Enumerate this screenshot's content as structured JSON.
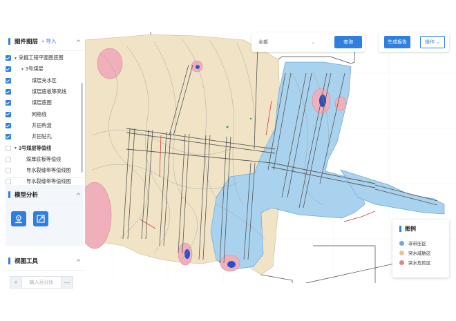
{
  "layers": {
    "title": "图件图层",
    "import_label": "+ 导入",
    "items": [
      {
        "label": "采掘工程平面图底图",
        "checked": true,
        "has_arrow": true,
        "bold": false
      },
      {
        "label": "3号煤层",
        "checked": true,
        "has_arrow": true,
        "bold": false
      },
      {
        "label": "煤层充水区",
        "checked": true,
        "has_arrow": false,
        "bold": false
      },
      {
        "label": "煤层底板等高线",
        "checked": true,
        "has_arrow": false,
        "bold": false
      },
      {
        "label": "煤层底图",
        "checked": true,
        "has_arrow": false,
        "bold": false
      },
      {
        "label": "网格线",
        "checked": true,
        "has_arrow": false,
        "bold": false
      },
      {
        "label": "井田构造",
        "checked": true,
        "has_arrow": false,
        "bold": false
      },
      {
        "label": "井田钻孔",
        "checked": true,
        "has_arrow": false,
        "bold": false
      },
      {
        "label": "3号煤层等值线",
        "checked": false,
        "has_arrow": true,
        "bold": true
      },
      {
        "label": "煤厚底板等值线",
        "checked": false,
        "has_arrow": false,
        "bold": false
      },
      {
        "label": "导水裂缝带等值线图",
        "checked": false,
        "has_arrow": false,
        "bold": false
      },
      {
        "label": "导水裂缝带等值线图",
        "checked": false,
        "has_arrow": false,
        "bold": false
      }
    ]
  },
  "analysis": {
    "title": "模型分析",
    "tools": [
      "location-analysis-icon",
      "area-analysis-icon"
    ]
  },
  "view_tools": {
    "title": "视图工具",
    "zoom_out": "+",
    "zoom_in": "—",
    "placeholder": "输入百分比"
  },
  "toolbar": {
    "select_value": "全部",
    "query_label": "查询",
    "report_label": "生成报告",
    "operate_label": "操作"
  },
  "legend": {
    "title": "图例",
    "items": [
      {
        "label": "非带压区",
        "color": "#6aa7dc"
      },
      {
        "label": "突水威胁区",
        "color": "#e8c48e"
      },
      {
        "label": "突水危险区",
        "color": "#e77f8d"
      }
    ]
  },
  "colors": {
    "accent": "#2f7fe0",
    "safe_zone": "#a9d2ee",
    "threat_zone": "#f1e4c6",
    "danger_zone": "#efb0bc"
  }
}
